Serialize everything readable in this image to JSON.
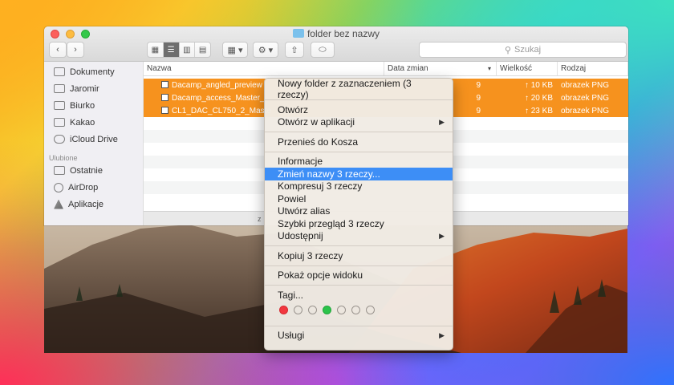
{
  "window": {
    "title": "folder bez nazwy",
    "search_placeholder": "Szukaj"
  },
  "sidebar": {
    "items": [
      {
        "label": "Dokumenty"
      },
      {
        "label": "Jaromir"
      },
      {
        "label": "Biurko"
      },
      {
        "label": "Kakao"
      },
      {
        "label": "iCloud Drive"
      }
    ],
    "favorites_heading": "Ulubione",
    "favorites": [
      {
        "label": "Ostatnie"
      },
      {
        "label": "AirDrop"
      },
      {
        "label": "Aplikacje"
      }
    ]
  },
  "list": {
    "columns": {
      "name": "Nazwa",
      "date": "Data zmian",
      "size": "Wielkość",
      "kind": "Rodzaj"
    },
    "rows": [
      {
        "name": "Dacamp_angled_preview",
        "date": "9",
        "size": "↑ 10 KB",
        "kind": "obrazek PNG"
      },
      {
        "name": "Dacamp_access_Master_",
        "date": "9",
        "size": "↑ 20 KB",
        "kind": "obrazek PNG"
      },
      {
        "name": "CL1_DAC_CL750_2_Maste",
        "date": "9",
        "size": "↑ 23 KB",
        "kind": "obrazek PNG"
      }
    ],
    "status_text": "z"
  },
  "context_menu": {
    "new_folder": "Nowy folder z zaznaczeniem (3 rzeczy)",
    "open": "Otwórz",
    "open_with": "Otwórz w aplikacji",
    "trash": "Przenieś do Kosza",
    "info": "Informacje",
    "rename": "Zmień nazwy 3 rzeczy...",
    "compress": "Kompresuj 3 rzeczy",
    "duplicate": "Powiel",
    "alias": "Utwórz alias",
    "quicklook": "Szybki przegląd 3 rzeczy",
    "share": "Udostępnij",
    "copy": "Kopiuj 3 rzeczy",
    "view_options": "Pokaż opcje widoku",
    "tags": "Tagi...",
    "services": "Usługi"
  },
  "colors": {
    "selection": "#f6921e",
    "highlight": "#3d8ef6",
    "tag_red": "#f2373f",
    "tag_green": "#2bc34a"
  }
}
